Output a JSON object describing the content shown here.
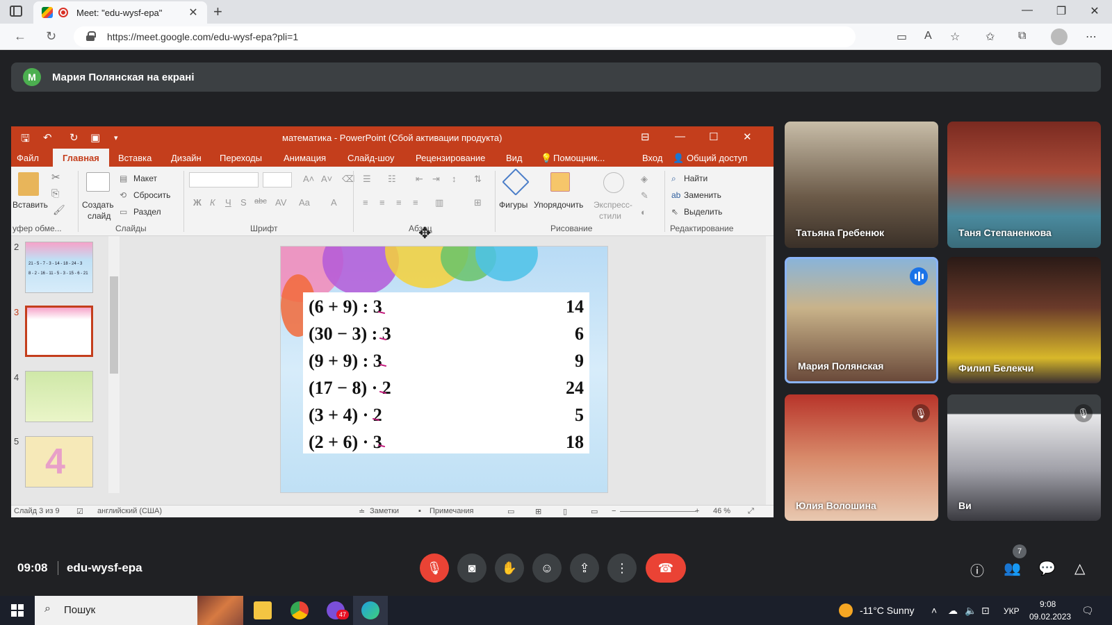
{
  "browser": {
    "tab_title": "Meet: \"edu-wysf-epa\"",
    "url": "https://meet.google.com/edu-wysf-epa?pli=1"
  },
  "banner": {
    "avatar_letter": "M",
    "text": "Мария Полянская на екрані"
  },
  "ppt": {
    "title": "математика - PowerPoint (Сбой активации продукта)",
    "menu": [
      "Файл",
      "Главная",
      "Вставка",
      "Дизайн",
      "Переходы",
      "Анимация",
      "Слайд-шоу",
      "Рецензирование",
      "Вид",
      "Помощник..."
    ],
    "signin": "Вход",
    "share": "Общий доступ",
    "ribbon": {
      "paste": "Вставить",
      "clipboard": "уфер обме...",
      "new_slide_1": "Создать",
      "new_slide_2": "слайд",
      "layout": "Макет",
      "reset": "Сбросить",
      "section": "Раздел",
      "slides": "Слайды",
      "font": "Шрифт",
      "paragraph": "Абзац",
      "shapes": "Фигуры",
      "arrange": "Упорядочить",
      "quick_styles_1": "Экспресс-",
      "quick_styles_2": "стили",
      "drawing": "Рисование",
      "find": "Найти",
      "replace": "Заменить",
      "select": "Выделить",
      "editing": "Редактирование"
    },
    "thumb_numbers": [
      "2",
      "3",
      "4",
      "5"
    ],
    "thumb2_lines": [
      "21 - 5 - 7 - 3 - 14 - 18 - 24 - 3",
      "8 - 2 - 16 - 11 - 5 - 3 - 15 - 6 - 21"
    ],
    "slide_rows": [
      {
        "expr": "(6 + 9) : 3",
        "answer": "14"
      },
      {
        "expr": "(30 − 3) : 3",
        "answer": "6"
      },
      {
        "expr": "(9 + 9) : 3",
        "answer": "9"
      },
      {
        "expr": "(17 − 8) · 2",
        "answer": "24"
      },
      {
        "expr": "(3 + 4) · 2",
        "answer": "5"
      },
      {
        "expr": "(2 + 6) · 3",
        "answer": "18"
      }
    ],
    "status": {
      "slide": "Слайд 3 из 9",
      "language": "английский (США)",
      "notes": "Заметки",
      "comments": "Примечания",
      "zoom": "46 %"
    }
  },
  "participants": [
    {
      "name": "Татьяна Гребенюк",
      "muted": false,
      "speaking": false
    },
    {
      "name": "Таня Степаненкова",
      "muted": false,
      "speaking": false
    },
    {
      "name": "Мария Полянская",
      "muted": false,
      "speaking": true
    },
    {
      "name": "Филип Белекчи",
      "muted": false,
      "speaking": false
    },
    {
      "name": "Юлия Волошина",
      "muted": true,
      "speaking": false
    },
    {
      "name": "Ви",
      "muted": true,
      "speaking": false
    }
  ],
  "meeting": {
    "time": "09:08",
    "code": "edu-wysf-epa",
    "people_count": "7"
  },
  "taskbar": {
    "search": "Пошук",
    "app_badge": "47",
    "weather": "-11°C  Sunny",
    "lang": "УКР",
    "time": "9:08",
    "date": "09.02.2023"
  }
}
